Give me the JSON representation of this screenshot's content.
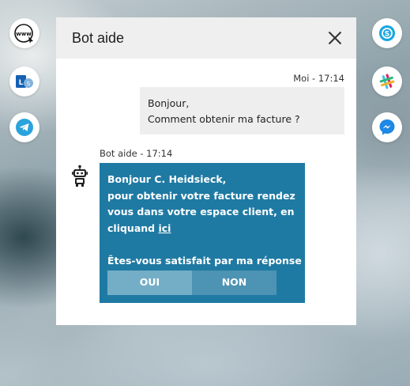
{
  "colors": {
    "bot_bubble": "#1f7aa3",
    "oui_button": "#74aec6",
    "non_button": "#4d93b3",
    "header_bg": "#efefef",
    "user_bubble": "#eeeeee"
  },
  "left_icons": [
    {
      "name": "www-icon"
    },
    {
      "name": "outlook-skype-icon"
    },
    {
      "name": "telegram-icon"
    }
  ],
  "right_icons": [
    {
      "name": "skype-icon"
    },
    {
      "name": "slack-icon"
    },
    {
      "name": "messenger-icon"
    }
  ],
  "chat": {
    "title": "Bot aide",
    "close_icon": "close-icon",
    "user_message": {
      "author_time": "Moi - 17:14",
      "line1": "Bonjour,",
      "line2": "Comment obtenir ma facture ?"
    },
    "bot_message": {
      "author_time": "Bot aide - 17:14",
      "line1": "Bonjour C. Heidsieck,",
      "line2": "pour obtenir votre facture rendez",
      "line3": "vous dans votre espace client, en",
      "line4_prefix": "cliquand ",
      "link_text": "ici",
      "question": "Êtes-vous satisfait par ma réponse ?",
      "yes_label": "OUI",
      "no_label": "NON"
    }
  }
}
